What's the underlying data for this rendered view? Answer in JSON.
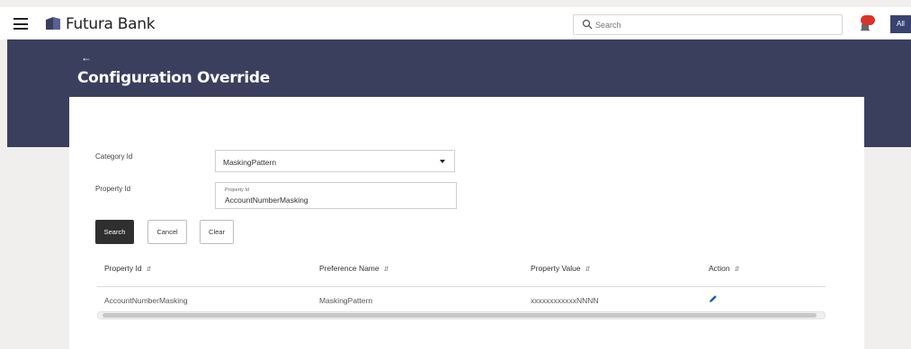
{
  "header": {
    "brand": "Futura Bank",
    "search_placeholder": "Search",
    "avatar_text": "All",
    "accent": "#3b3f5e",
    "badge_color": "#d9342b"
  },
  "page": {
    "back_icon": "back-arrow-icon",
    "title": "Configuration Override"
  },
  "form": {
    "category_label": "Category Id",
    "category_value": "MaskingPattern",
    "property_label": "Property Id",
    "property_float_label": "Property Id",
    "property_value": "AccountNumberMasking"
  },
  "buttons": {
    "search": "Search",
    "cancel": "Cancel",
    "clear": "Clear"
  },
  "table": {
    "columns": [
      "Property Id",
      "Preference Name",
      "Property Value",
      "Action"
    ],
    "rows": [
      {
        "property_id": "AccountNumberMasking",
        "preference_name": "MaskingPattern",
        "property_value": "xxxxxxxxxxxxNNNN",
        "action": "edit-icon"
      }
    ]
  }
}
